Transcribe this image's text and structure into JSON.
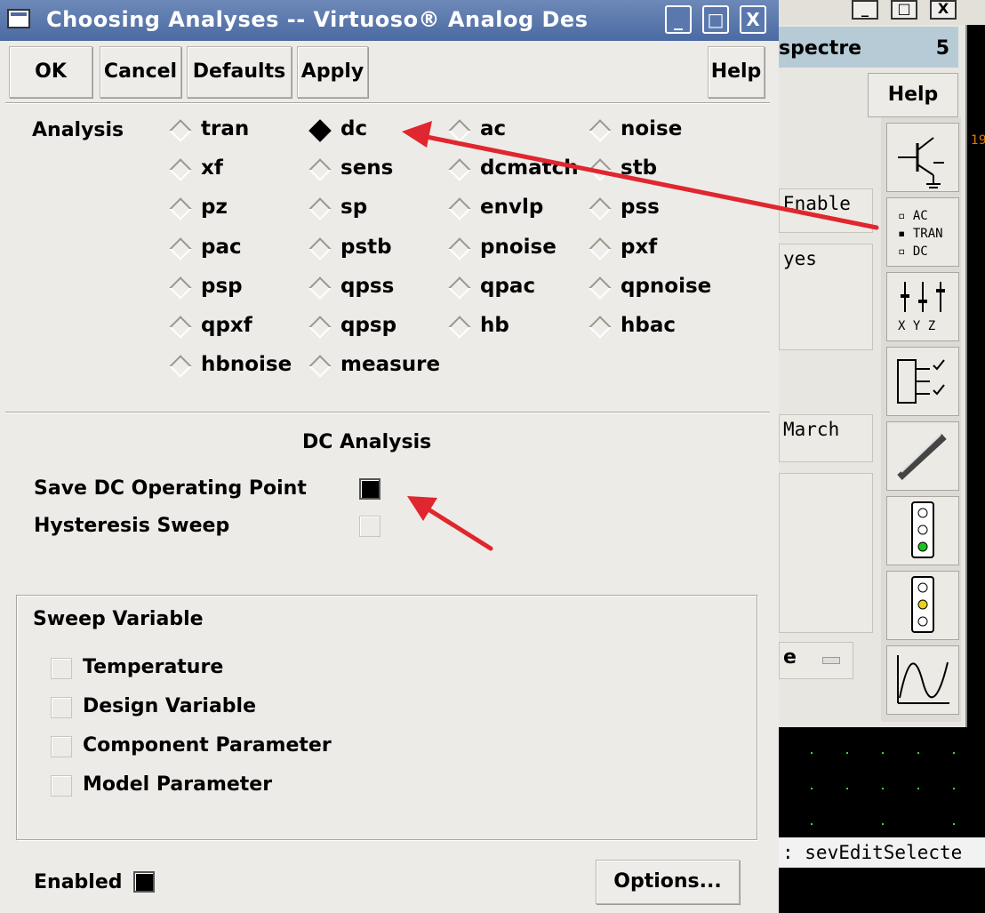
{
  "dialog": {
    "title": "Choosing Analyses -- Virtuoso® Analog Des",
    "window_buttons": [
      "_",
      "□",
      "X"
    ],
    "buttons": {
      "ok": "OK",
      "cancel": "Cancel",
      "defaults": "Defaults",
      "apply": "Apply",
      "help": "Help"
    }
  },
  "analysis": {
    "label": "Analysis",
    "selected": "dc",
    "options": [
      [
        "tran",
        "dc",
        "ac",
        "noise"
      ],
      [
        "xf",
        "sens",
        "dcmatch",
        "stb"
      ],
      [
        "pz",
        "sp",
        "envlp",
        "pss"
      ],
      [
        "pac",
        "pstb",
        "pnoise",
        "pxf"
      ],
      [
        "psp",
        "qpss",
        "qpac",
        "qpnoise"
      ],
      [
        "qpxf",
        "qpsp",
        "hb",
        "hbac"
      ],
      [
        "hbnoise",
        "measure"
      ]
    ]
  },
  "dc_section": {
    "heading": "DC Analysis",
    "save_op_label": "Save DC Operating Point",
    "save_op_checked": true,
    "hysteresis_label": "Hysteresis Sweep",
    "hysteresis_checked": false
  },
  "sweep": {
    "heading": "Sweep Variable",
    "items": [
      "Temperature",
      "Design Variable",
      "Component Parameter",
      "Model Parameter"
    ]
  },
  "footer": {
    "enabled_label": "Enabled",
    "enabled_checked": true,
    "options_button": "Options..."
  },
  "background_window": {
    "window_buttons": [
      "_",
      "□",
      "X"
    ],
    "simulator_label": "spectre",
    "simulator_num": "5",
    "help_label": "Help",
    "cells": [
      "Enable",
      "yes",
      "March",
      "e"
    ],
    "tool_labels": {
      "ac": "AC",
      "tran": "TRAN",
      "dc": "DC",
      "xyz": "X Y Z"
    },
    "status_text": ": sevEditSelecte",
    "orange_fragment": "19"
  },
  "colors": {
    "title_bar": "#4b6aa2",
    "sim_header": "#b7cbd6",
    "annotation_arrow": "#e0262e",
    "dialog_bg": "#edebe7"
  }
}
